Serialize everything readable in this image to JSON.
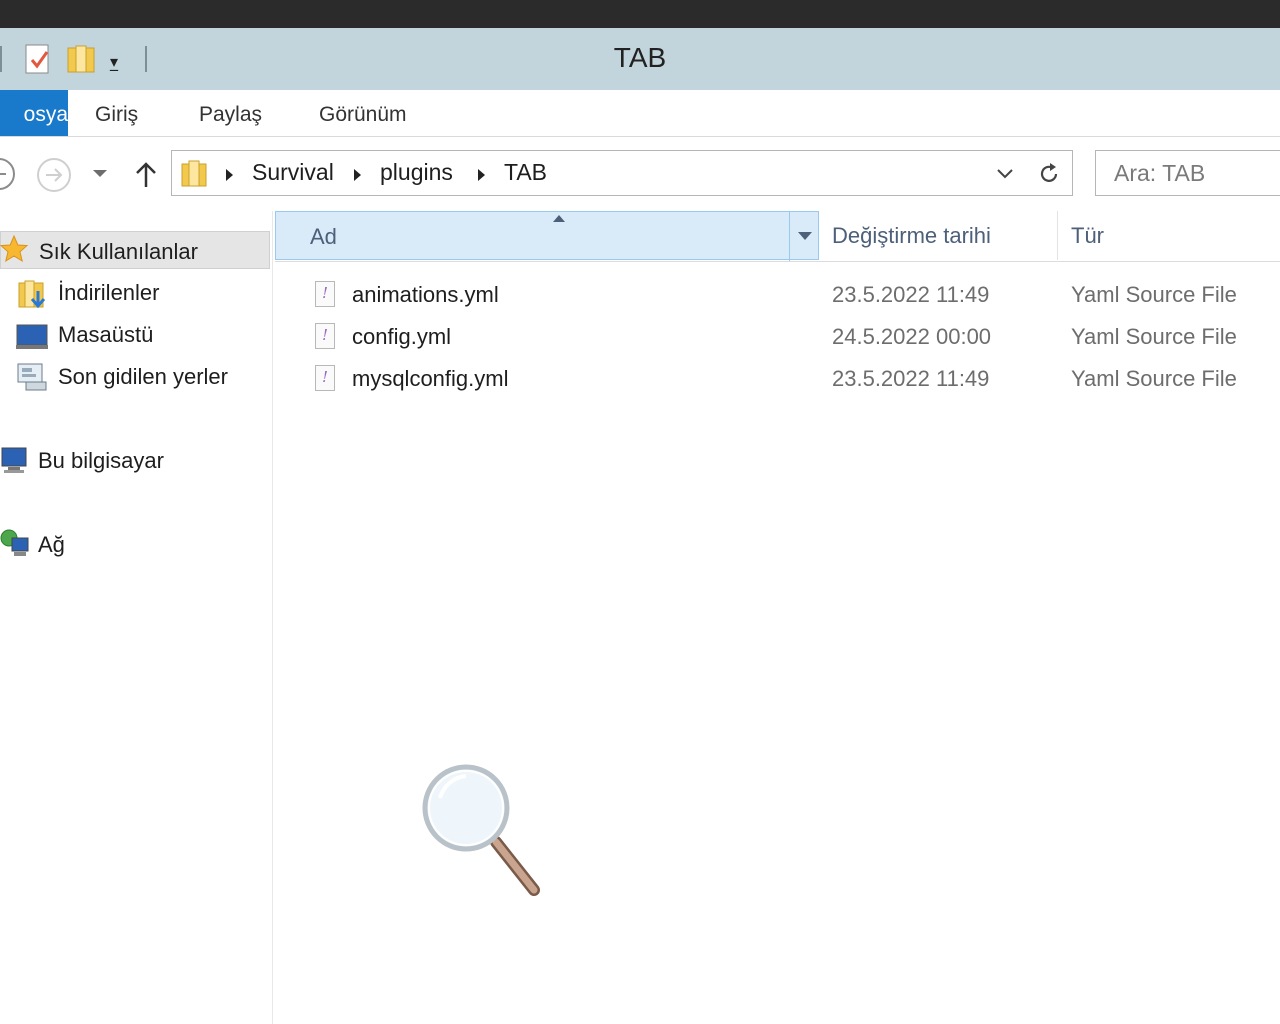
{
  "window": {
    "title": "TAB"
  },
  "quick_access": {
    "icons": [
      "properties-icon",
      "new-folder-icon",
      "customize-dropdown-icon"
    ]
  },
  "ribbon": {
    "tabs": [
      {
        "label": "Dosya",
        "visible": "osya",
        "active": true
      },
      {
        "label": "Giriş"
      },
      {
        "label": "Paylaş"
      },
      {
        "label": "Görünüm"
      }
    ]
  },
  "address_bar": {
    "breadcrumbs": [
      "Survival",
      "plugins",
      "TAB"
    ]
  },
  "search": {
    "placeholder": "Ara: TAB"
  },
  "nav_pane": {
    "favorites": "Sık Kullanılanlar",
    "items": [
      "İndirilenler",
      "Masaüstü",
      "Son gidilen yerler"
    ],
    "this_pc": "Bu bilgisayar",
    "network": "Ağ"
  },
  "columns": {
    "name": "Ad",
    "date": "Değiştirme tarihi",
    "type": "Tür"
  },
  "files": [
    {
      "name": "animations.yml",
      "date": "23.5.2022 11:49",
      "type": "Yaml Source File"
    },
    {
      "name": "config.yml",
      "date": "24.5.2022 00:00",
      "type": "Yaml Source File"
    },
    {
      "name": "mysqlconfig.yml",
      "date": "23.5.2022 11:49",
      "type": "Yaml Source File"
    }
  ],
  "colors": {
    "accent": "#1979ca",
    "titlebar": "#c3d5dc",
    "header_selected": "#d9ebf9"
  }
}
